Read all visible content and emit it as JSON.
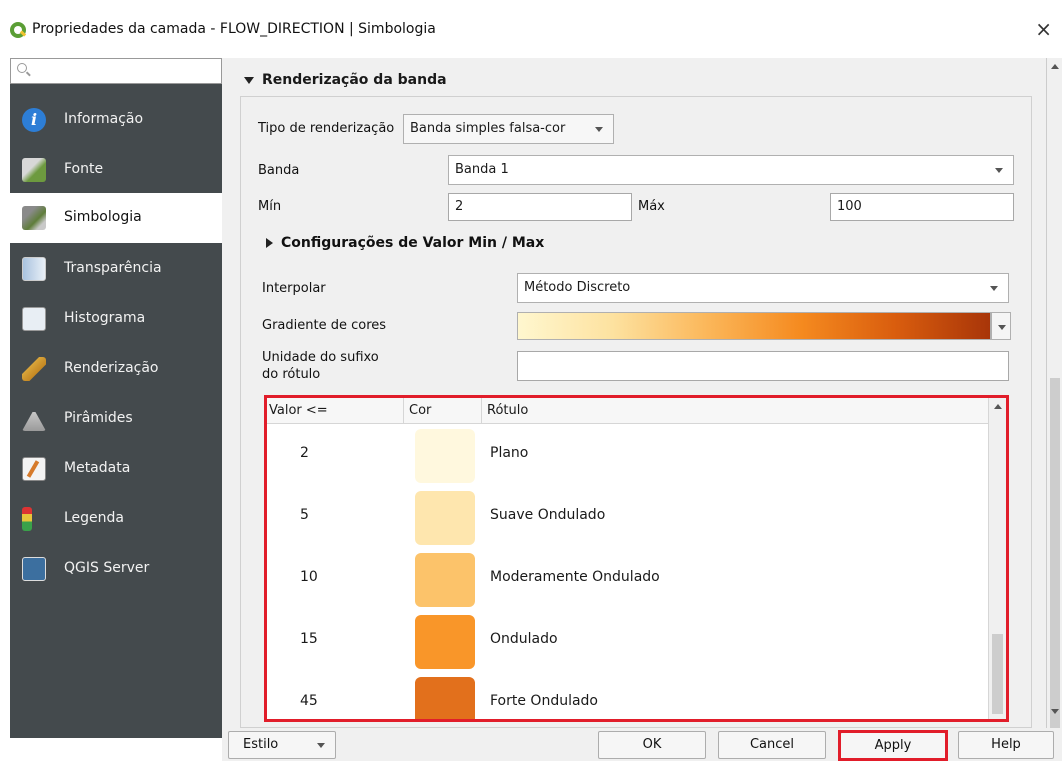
{
  "window": {
    "title": "Propriedades da camada - FLOW_DIRECTION | Simbologia",
    "close_glyph": "×"
  },
  "sidebar": {
    "search_placeholder": "",
    "items": [
      {
        "label": "Informação",
        "icon": "info-icon"
      },
      {
        "label": "Fonte",
        "icon": "source-icon"
      },
      {
        "label": "Simbologia",
        "icon": "symbology-icon",
        "active": true
      },
      {
        "label": "Transparência",
        "icon": "transparency-icon"
      },
      {
        "label": "Histograma",
        "icon": "histogram-icon"
      },
      {
        "label": "Renderização",
        "icon": "rendering-icon"
      },
      {
        "label": "Pirâmides",
        "icon": "pyramids-icon"
      },
      {
        "label": "Metadata",
        "icon": "metadata-icon"
      },
      {
        "label": "Legenda",
        "icon": "legend-icon"
      },
      {
        "label": "QGIS Server",
        "icon": "qgis-server-icon"
      }
    ]
  },
  "band_rendering": {
    "section_title": "Renderização da banda",
    "render_type_label": "Tipo de renderização",
    "render_type_value": "Banda simples falsa-cor",
    "band_label": "Banda",
    "band_value": "Banda 1",
    "min_label": "Mín",
    "min_value": "2",
    "max_label": "Máx",
    "max_value": "100",
    "minmax_section": "Configurações de Valor Min / Max",
    "interpolate_label": "Interpolar",
    "interpolate_value": "Método Discreto",
    "color_ramp_label": "Gradiente de cores",
    "suffix_label_line1": "Unidade do sufixo",
    "suffix_label_line2": "do rótulo",
    "suffix_value": ""
  },
  "classes_table": {
    "headers": {
      "value": "Valor <=",
      "color": "Cor",
      "label": "Rótulo"
    },
    "rows": [
      {
        "value": "2",
        "color": "#fff8de",
        "label": "Plano"
      },
      {
        "value": "5",
        "color": "#fee6ae",
        "label": "Suave Ondulado"
      },
      {
        "value": "10",
        "color": "#fcc36a",
        "label": "Moderamente Ondulado"
      },
      {
        "value": "15",
        "color": "#f99629",
        "label": "Ondulado"
      },
      {
        "value": "45",
        "color": "#e2701c",
        "label": "Forte Ondulado"
      }
    ]
  },
  "buttons": {
    "style": "Estilo",
    "ok": "OK",
    "cancel": "Cancel",
    "apply": "Apply",
    "help": "Help"
  },
  "highlight_color": "#e11d2a"
}
